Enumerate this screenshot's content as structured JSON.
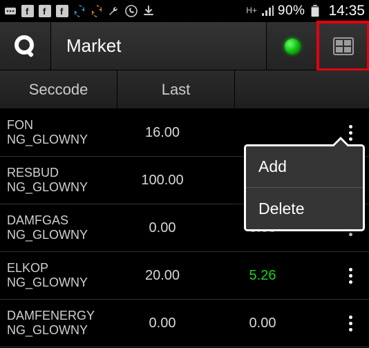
{
  "statusbar": {
    "battery_pct": "90%",
    "clock": "14:35",
    "signal_indicator": "H+"
  },
  "titlebar": {
    "title": "Market"
  },
  "columns": {
    "c1": "Seccode",
    "c2": "Last",
    "c3": ""
  },
  "popup": {
    "items": [
      {
        "label": "Add"
      },
      {
        "label": "Delete"
      }
    ]
  },
  "rows": [
    {
      "code1": "FON",
      "code2": "NG_GLOWNY",
      "last": "16.00",
      "chg": "",
      "chg_class": "neg"
    },
    {
      "code1": "RESBUD",
      "code2": "NG_GLOWNY",
      "last": "100.00",
      "chg": "",
      "chg_class": "pos"
    },
    {
      "code1": "DAMFGAS",
      "code2": "NG_GLOWNY",
      "last": "0.00",
      "chg": "0.00",
      "chg_class": "zero"
    },
    {
      "code1": "ELKOP",
      "code2": "NG_GLOWNY",
      "last": "20.00",
      "chg": "5.26",
      "chg_class": "pos"
    },
    {
      "code1": "DAMFENERGY",
      "code2": "NG_GLOWNY",
      "last": "0.00",
      "chg": "0.00",
      "chg_class": "zero"
    }
  ]
}
